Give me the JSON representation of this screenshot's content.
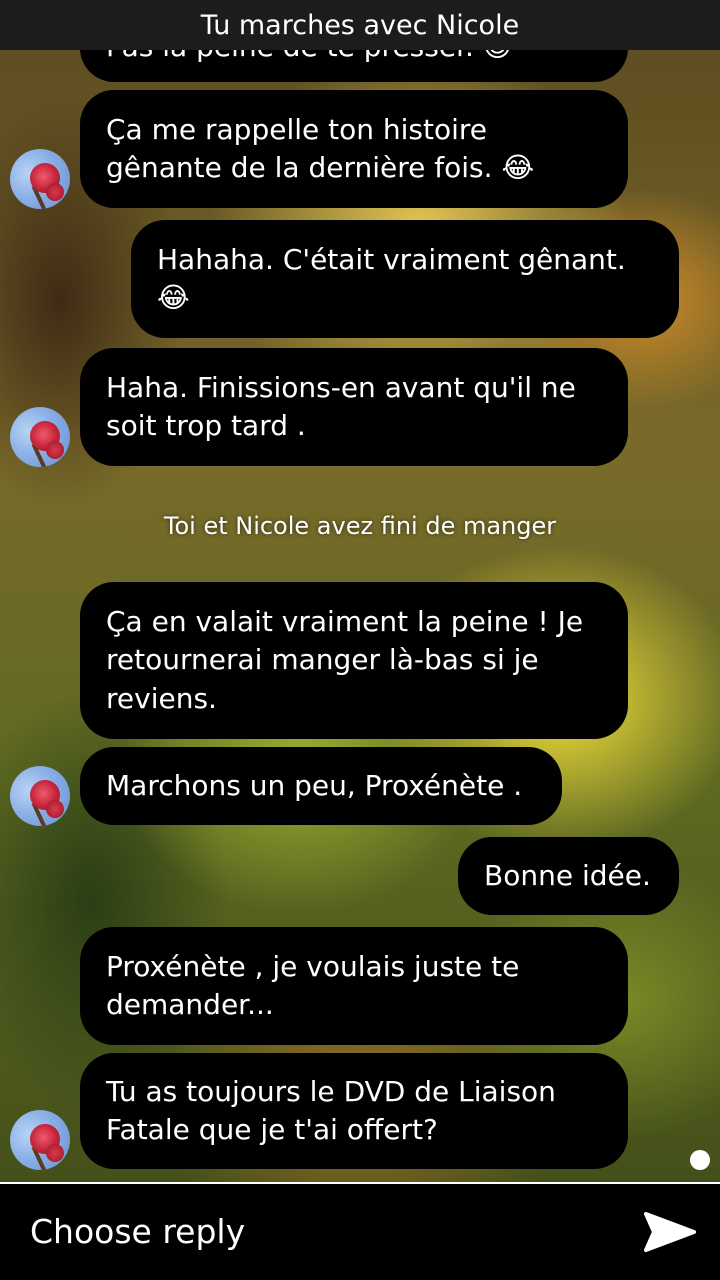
{
  "header": {
    "title": "Tu marches avec Nicole"
  },
  "messages": [
    {
      "from": "nicole",
      "text": "Pas la peine de te presser. 😊"
    },
    {
      "from": "nicole",
      "text": "Ça me rappelle ton histoire gênante de la dernière fois. 😂"
    },
    {
      "from": "me",
      "text": "Hahaha. C'était vraiment gênant. 😂"
    },
    {
      "from": "nicole",
      "text": "Haha. Finissions-en avant qu'il ne soit trop tard ."
    },
    {
      "from": "nicole",
      "text": "Ça en valait vraiment la peine ! Je retournerai manger là-bas si je reviens."
    },
    {
      "from": "nicole",
      "text": "Marchons un peu, Proxénète ."
    },
    {
      "from": "me",
      "text": "Bonne idée."
    },
    {
      "from": "nicole",
      "text": "Proxénète , je voulais juste te demander..."
    },
    {
      "from": "nicole",
      "text": "Tu as toujours le DVD de Liaison Fatale que je t'ai offert?"
    }
  ],
  "system_message": "Toi et Nicole avez fini de manger",
  "reply_bar": {
    "placeholder": "Choose reply",
    "send_icon": "send-arrow-icon"
  },
  "colors": {
    "bubble": "#000000",
    "text": "#ffffff",
    "header": "#1c1c1c"
  }
}
